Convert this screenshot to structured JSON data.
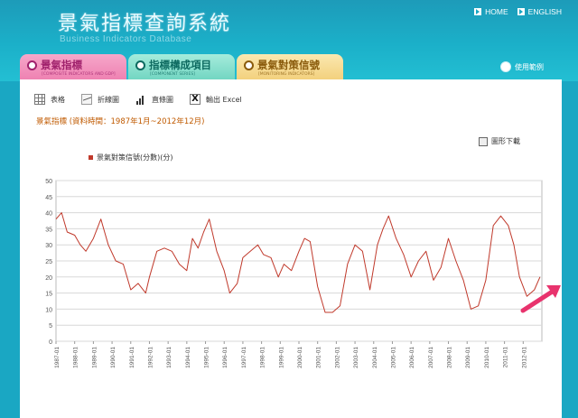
{
  "header": {
    "title": "景氣指標查詢系統",
    "subtitle": "Business Indicators Database",
    "nav": [
      {
        "label": "HOME"
      },
      {
        "label": "ENGLISH"
      }
    ],
    "help_label": "使用範例"
  },
  "tabs": [
    {
      "label": "景氣指標",
      "sub": "[COMPOSITE INDICATORS AND GDP]"
    },
    {
      "label": "指標構成項目",
      "sub": "[COMPONENT SERIES]"
    },
    {
      "label": "景氣對策信號",
      "sub": "[MONITORING INDICATORS]"
    }
  ],
  "toolbar": {
    "table_label": "表格",
    "line_label": "折線圖",
    "bar_label": "直條圖",
    "excel_label": "輸出 Excel"
  },
  "period_text": "景氣指標 (資料時間：1987年1月~2012年12月)",
  "download_label": "圖形下載",
  "colors": {
    "series": "#c0392b",
    "accent": "#1aa7c3",
    "arrow": "#e8336d"
  },
  "chart_data": {
    "type": "line",
    "legend": "景氣對策信號(分數)(分)",
    "ylim": [
      0,
      50
    ],
    "yticks": [
      0,
      5,
      10,
      15,
      20,
      25,
      30,
      35,
      40,
      45,
      50
    ],
    "xticks": [
      "1987-01",
      "1988-01",
      "1989-01",
      "1990-01",
      "1991-01",
      "1992-01",
      "1993-01",
      "1994-01",
      "1995-01",
      "1996-01",
      "1997-01",
      "1998-01",
      "1999-01",
      "2000-01",
      "2001-01",
      "2002-01",
      "2003-01",
      "2004-01",
      "2005-01",
      "2006-01",
      "2007-01",
      "2008-01",
      "2009-01",
      "2010-01",
      "2011-01",
      "2012-01"
    ],
    "grid": true,
    "series": [
      {
        "name": "景氣對策信號(分數)(分)",
        "x": [
          1987.0,
          1987.3,
          1987.6,
          1988.0,
          1988.3,
          1988.6,
          1989.0,
          1989.4,
          1989.8,
          1990.2,
          1990.6,
          1991.0,
          1991.4,
          1991.8,
          1992.0,
          1992.4,
          1992.8,
          1993.2,
          1993.6,
          1994.0,
          1994.3,
          1994.6,
          1994.9,
          1995.2,
          1995.6,
          1996.0,
          1996.3,
          1996.7,
          1997.0,
          1997.4,
          1997.8,
          1998.1,
          1998.5,
          1998.9,
          1999.2,
          1999.6,
          2000.0,
          2000.3,
          2000.6,
          2001.0,
          2001.4,
          2001.8,
          2002.2,
          2002.6,
          2003.0,
          2003.4,
          2003.8,
          2004.2,
          2004.5,
          2004.8,
          2005.2,
          2005.6,
          2006.0,
          2006.4,
          2006.8,
          2007.2,
          2007.6,
          2008.0,
          2008.4,
          2008.8,
          2009.2,
          2009.6,
          2010.0,
          2010.4,
          2010.8,
          2011.2,
          2011.5,
          2011.8,
          2012.2,
          2012.6,
          2012.9
        ],
        "values": [
          38,
          40,
          34,
          33,
          30,
          28,
          32,
          38,
          30,
          25,
          24,
          16,
          18,
          15,
          20,
          28,
          29,
          28,
          24,
          22,
          32,
          29,
          34,
          38,
          28,
          22,
          15,
          18,
          26,
          28,
          30,
          27,
          26,
          20,
          24,
          22,
          28,
          32,
          31,
          17,
          9,
          9,
          11,
          24,
          30,
          28,
          16,
          30,
          35,
          39,
          32,
          27,
          20,
          25,
          28,
          19,
          23,
          32,
          25,
          19,
          10,
          11,
          19,
          36,
          39,
          36,
          30,
          20,
          14,
          16,
          20
        ]
      }
    ]
  }
}
